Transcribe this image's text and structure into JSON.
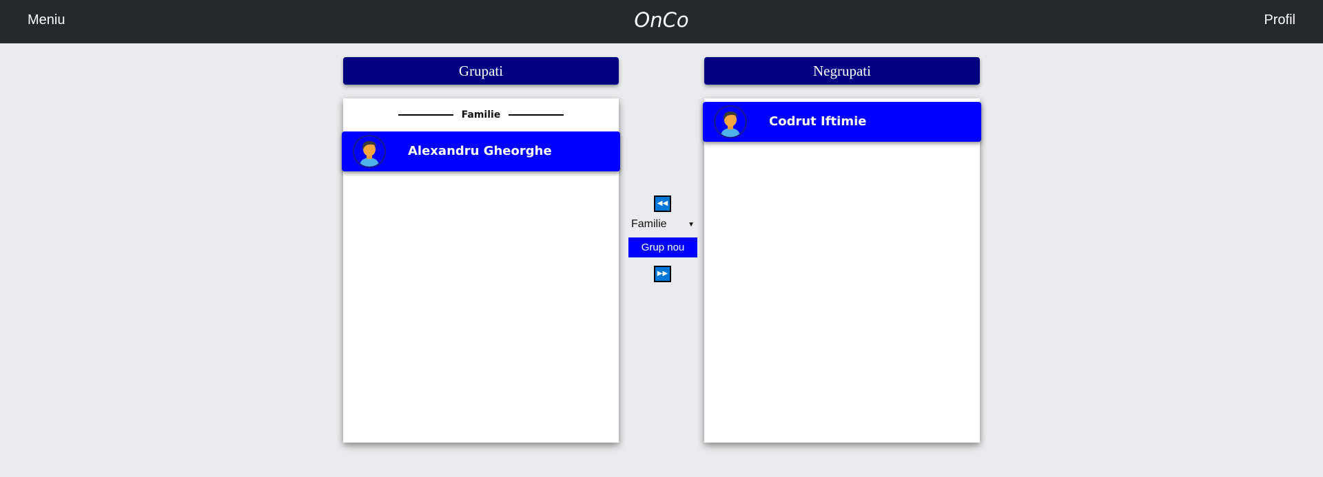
{
  "navbar": {
    "menu_label": "Meniu",
    "brand": "OnCo",
    "profile_label": "Profil"
  },
  "grouped": {
    "header": "Grupati",
    "group_name": "Familie",
    "contacts": [
      {
        "name": "Alexandru Gheorghe",
        "avatar_icon": "user-avatar-icon"
      }
    ]
  },
  "ungrouped": {
    "header": "Negrupati",
    "contacts": [
      {
        "name": "Codrut Iftimie",
        "avatar_icon": "user-avatar-icon"
      }
    ]
  },
  "controls": {
    "move_left_icon": "double-left-arrow-icon",
    "move_right_icon": "double-right-arrow-icon",
    "selected_group": "Familie",
    "new_group_label": "Grup nou"
  },
  "colors": {
    "navbar": "#24292e",
    "header": "#000080",
    "card": "#0000ff",
    "background": "#e9ebee",
    "arrow_button": "#0078d7"
  }
}
